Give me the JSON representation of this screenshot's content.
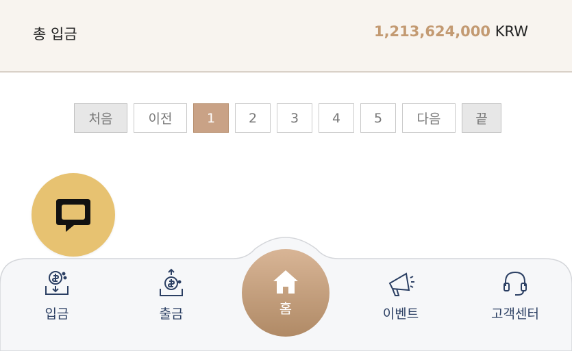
{
  "summary": {
    "label": "총 입금",
    "amount": "1,213,624,000",
    "currency": "KRW"
  },
  "pagination": {
    "first": "처음",
    "prev": "이전",
    "pages": [
      "1",
      "2",
      "3",
      "4",
      "5"
    ],
    "active_page": "1",
    "next": "다음",
    "last": "끝"
  },
  "chat": {
    "icon": "chat-bubble-icon"
  },
  "bottom_nav": {
    "deposit_label": "입금",
    "withdraw_label": "출금",
    "home_label": "홈",
    "event_label": "이벤트",
    "support_label": "고객센터"
  },
  "colors": {
    "accent": "#c39a72",
    "chat_button": "#e7c271",
    "nav_text": "#2b3f63",
    "active_page": "#c9a286"
  }
}
